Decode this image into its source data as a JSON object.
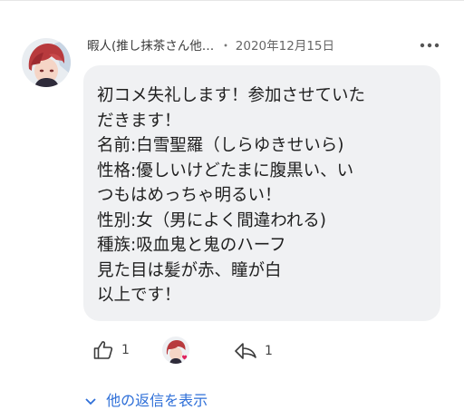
{
  "comment": {
    "author": "暇人(推し抹茶さん他…",
    "separator": "・",
    "date": "2020年12月15日",
    "body_lines": [
      "初コメ失礼します！参加させていた",
      "だきます！",
      "名前:白雪聖羅（しらゆきせいら)",
      "性格:優しいけどたまに腹黒い、い",
      "つもはめっちゃ明るい！",
      "性別:女（男によく間違われる)",
      "種族:吸血鬼と鬼のハーフ",
      "見た目は髪が赤、瞳が白",
      "以上です！"
    ]
  },
  "actions": {
    "like_count": "1",
    "reply_count": "1"
  },
  "replies_link_label": "他の返信を表示",
  "icons": {
    "like": "thumbs-up-icon",
    "reply": "reply-arrow-icon",
    "more": "more-vertical-dots-icon",
    "replies_chevron": "chevron-down-icon"
  },
  "colors": {
    "bubble": "#f0f1f3",
    "link": "#2e6fd8",
    "text": "#1f1f1f",
    "meta": "#666666"
  }
}
